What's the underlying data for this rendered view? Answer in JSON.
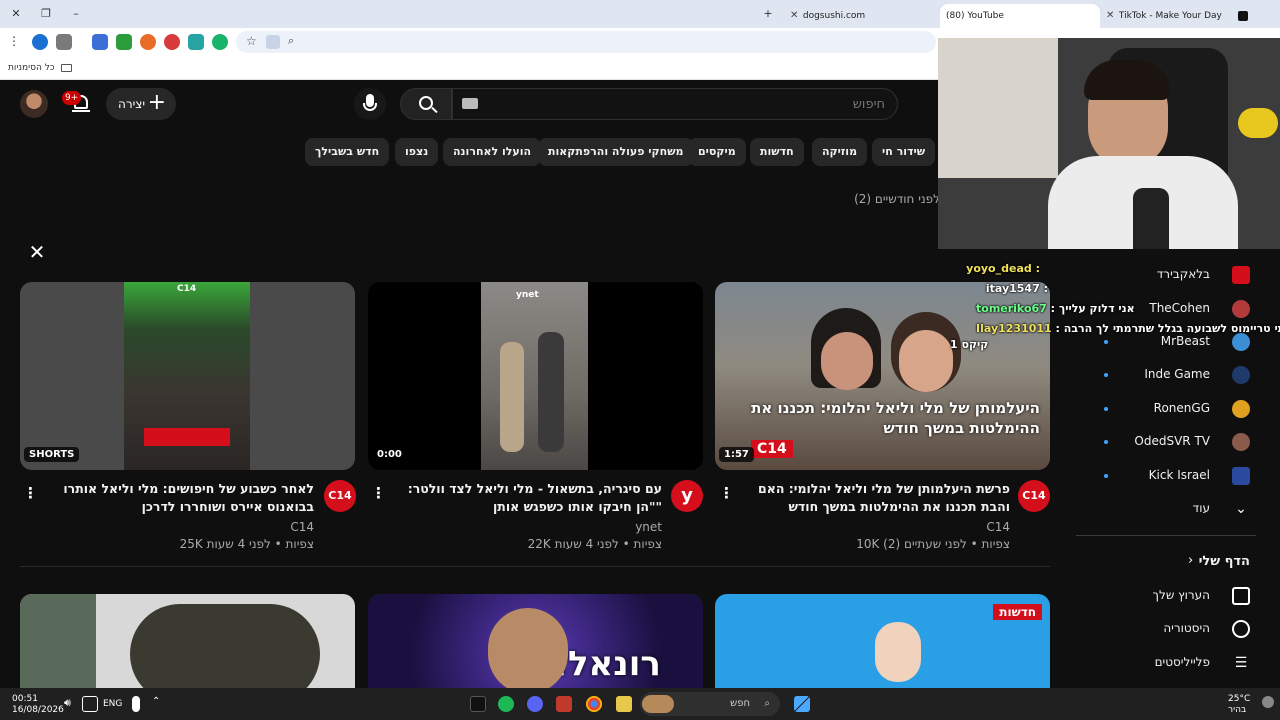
{
  "browser": {
    "tabs": [
      {
        "title": "dogsushi.com",
        "active": false
      },
      {
        "title": "(80) YouTube",
        "active": true
      },
      {
        "title": "TikTok - Make Your Day",
        "active": false
      }
    ],
    "bookmarks_folder": "כל הסימניות"
  },
  "header": {
    "notification_count": "9+",
    "create_label": "יצירה",
    "search_placeholder": "חיפוש"
  },
  "chips": [
    "שידור חי",
    "מוזיקה",
    "חדשות",
    "מיקסים",
    "משחקי פעולה והרפתקאות",
    "הועלו לאחרונה",
    "נצפו",
    "חדש בשבילך"
  ],
  "section_note": "לפני חודשיים (2)",
  "videos": [
    {
      "title": "פרשת היעלמותן של מלי וליאל יהלומי: האם והבת תכננו את ההימלטות במשך חודש",
      "channel": "C14",
      "meta": "10K צפיות • לפני שעתיים (2)",
      "duration": "1:57",
      "thumb_caption": "היעלמותן של מלי וליאל יהלומי: תכננו את ההימלטות במשך חודש",
      "thumb_logo": "C14"
    },
    {
      "title": "עם סיגריה, בתשאול - מלי וליאל לצד וולטר: \"הן חיבקו אותו כשפגש אותן\"",
      "channel": "ynet",
      "meta": "22K צפיות • לפני 4 שעות",
      "duration": "0:00",
      "thumb_logo": "ynet"
    },
    {
      "title": "לאחר כשבוע של חיפושים: מלי וליאל אותרו בבואנוס איירס ושוחררו לדרכן",
      "channel": "C14",
      "meta": "25K צפיות • לפני 4 שעות",
      "duration": "SHORTS",
      "thumb_logo": "C14"
    }
  ],
  "row2": {
    "news_label": "חדשות",
    "ronald_text": "רונאלד"
  },
  "sidebar": {
    "subscriptions": [
      {
        "name": "בלאקבירד"
      },
      {
        "name": "TheCohen"
      },
      {
        "name": "MrBeast"
      },
      {
        "name": "Inde Game"
      },
      {
        "name": "RonenGG"
      },
      {
        "name": "OdedSVR TV"
      },
      {
        "name": "Kick Israel"
      }
    ],
    "more_label": "עוד",
    "you_label": "הדף שלי",
    "you_items": [
      "הערוץ שלך",
      "היסטוריה",
      "פלייליסטים"
    ]
  },
  "stream_chat": [
    {
      "user": "yoyo_dead",
      "text": ":",
      "color": "#f1e05a"
    },
    {
      "user": "itay1547",
      "text": ":",
      "color": "#ffffff"
    },
    {
      "user": "tomeriko67",
      "text": ": אני דלוק עלייך",
      "color": "#6bff8a"
    },
    {
      "user": "Ilay1231011",
      "text": ": שלך קיבלתי טריימוס לשבועה בגלל שתרמתי לך הרבה",
      "color": "#f1e05a"
    },
    {
      "user": "",
      "text": "קיקס 1",
      "color": "#ffffff"
    }
  ],
  "taskbar": {
    "time": "00:51",
    "date": "16/08/2026",
    "lang": "ENG",
    "search_label": "חפש",
    "weather": "25°C",
    "weather_desc": "בהיר"
  }
}
